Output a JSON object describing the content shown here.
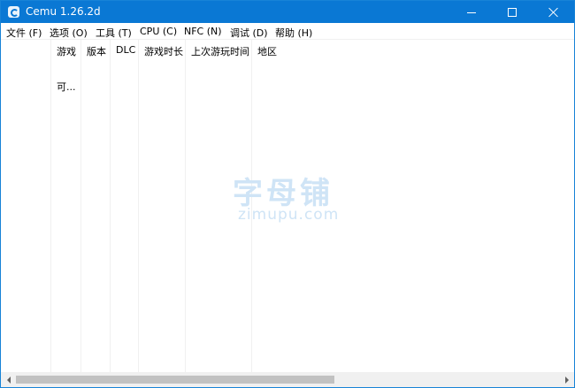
{
  "window": {
    "title": "Cemu 1.26.2d",
    "title_bar_color": "#0a78d4"
  },
  "icons": {
    "app": "cemu-app-icon",
    "minimize": "minimize-icon",
    "maximize": "maximize-icon",
    "close": "close-icon",
    "scroll_left": "arrow-left-icon",
    "scroll_right": "arrow-right-icon"
  },
  "menu": [
    {
      "label": "文件 (F)"
    },
    {
      "label": "选项 (O)"
    },
    {
      "label": "工具 (T)"
    },
    {
      "label": "CPU (C)"
    },
    {
      "label": "NFC (N)"
    },
    {
      "label": "调试 (D)"
    },
    {
      "label": "帮助 (H)"
    }
  ],
  "table": {
    "columns": [
      "游戏",
      "版本",
      "DLC",
      "游戏时长",
      "上次游玩时间",
      "地区"
    ],
    "rows": [
      {
        "game": "可..."
      }
    ]
  },
  "watermark": {
    "chinese": "字母铺",
    "site": "zimupu.com"
  },
  "scrollbar": {
    "horizontal_position": 0.0
  }
}
